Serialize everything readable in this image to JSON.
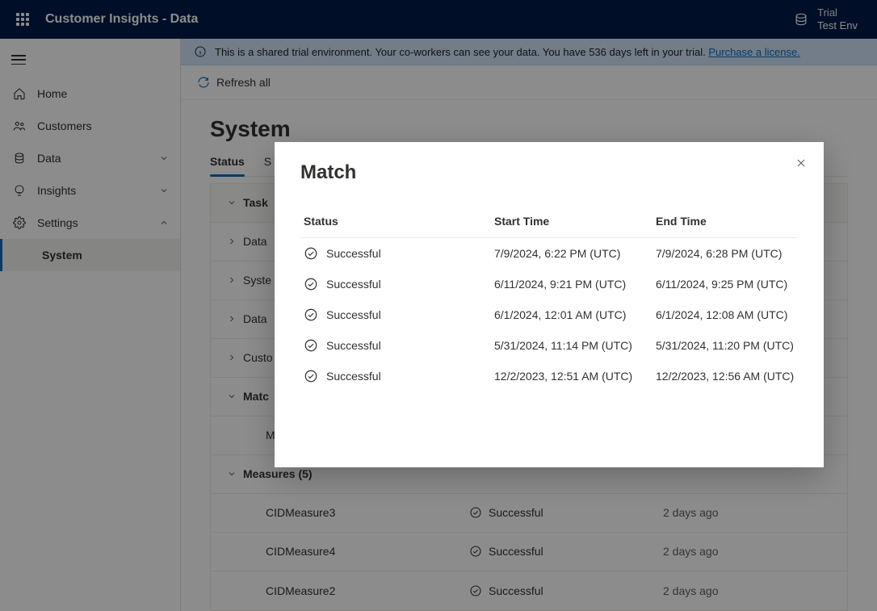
{
  "header": {
    "app_title": "Customer Insights - Data",
    "env_label": "Trial",
    "env_name": "Test Env"
  },
  "nav": {
    "home": "Home",
    "customers": "Customers",
    "data": "Data",
    "insights": "Insights",
    "settings": "Settings",
    "system": "System"
  },
  "banner": {
    "text": "This is a shared trial environment. Your co-workers can see your data. You have 536 days left in your trial. ",
    "link_text": "Purchase a license."
  },
  "command": {
    "refresh_all": "Refresh all"
  },
  "page": {
    "title": "System",
    "tabs": {
      "status": "Status",
      "second_partial": "S"
    }
  },
  "status_grid": {
    "cols": {
      "task": "Task"
    },
    "rows": {
      "data_sources": "Data",
      "system": "Syste",
      "data_prep": "Data",
      "customer": "Custo"
    },
    "match_group": "Matc",
    "match_row": "Mat",
    "measures_group": "Measures (5)",
    "measures": [
      {
        "name": "CIDMeasure3",
        "status": "Successful",
        "time": "2 days ago"
      },
      {
        "name": "CIDMeasure4",
        "status": "Successful",
        "time": "2 days ago"
      },
      {
        "name": "CIDMeasure2",
        "status": "Successful",
        "time": "2 days ago"
      }
    ]
  },
  "modal": {
    "title": "Match",
    "cols": {
      "status": "Status",
      "start": "Start Time",
      "end": "End Time"
    },
    "rows": [
      {
        "status": "Successful",
        "start": "7/9/2024, 6:22 PM (UTC)",
        "end": "7/9/2024, 6:28 PM (UTC)"
      },
      {
        "status": "Successful",
        "start": "6/11/2024, 9:21 PM (UTC)",
        "end": "6/11/2024, 9:25 PM (UTC)"
      },
      {
        "status": "Successful",
        "start": "6/1/2024, 12:01 AM (UTC)",
        "end": "6/1/2024, 12:08 AM (UTC)"
      },
      {
        "status": "Successful",
        "start": "5/31/2024, 11:14 PM (UTC)",
        "end": "5/31/2024, 11:20 PM (UTC)"
      },
      {
        "status": "Successful",
        "start": "12/2/2023, 12:51 AM (UTC)",
        "end": "12/2/2023, 12:56 AM (UTC)"
      }
    ]
  }
}
